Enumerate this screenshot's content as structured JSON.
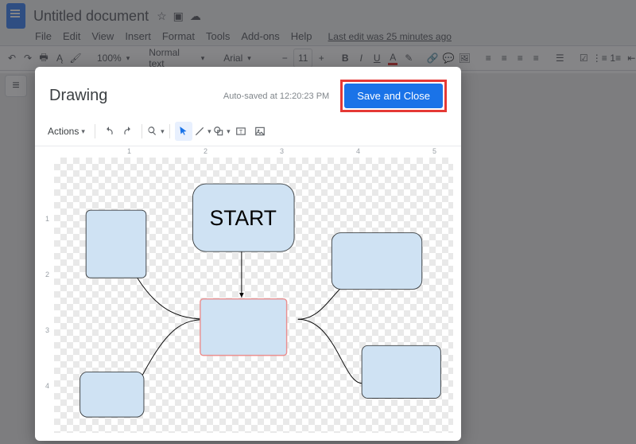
{
  "docs": {
    "title": "Untitled document",
    "menus": [
      "File",
      "Edit",
      "View",
      "Insert",
      "Format",
      "Tools",
      "Add-ons",
      "Help"
    ],
    "last_edit": "Last edit was 25 minutes ago",
    "toolbar": {
      "zoom": "100%",
      "style": "Normal text",
      "font": "Arial",
      "font_size": "11"
    }
  },
  "dialog": {
    "title": "Drawing",
    "autosave": "Auto-saved at 12:20:23 PM",
    "save_button": "Save and Close",
    "actions_label": "Actions",
    "h_ruler": [
      "1",
      "2",
      "3",
      "4",
      "5"
    ],
    "v_ruler": [
      "1",
      "2",
      "3",
      "4"
    ]
  },
  "shapes": {
    "start_label": "START"
  },
  "colors": {
    "shape_fill": "#cfe2f3",
    "shape_stroke": "#3c4043",
    "selected_stroke": "#ea8f8f",
    "accent": "#1a73e8",
    "highlight": "#e53935"
  }
}
